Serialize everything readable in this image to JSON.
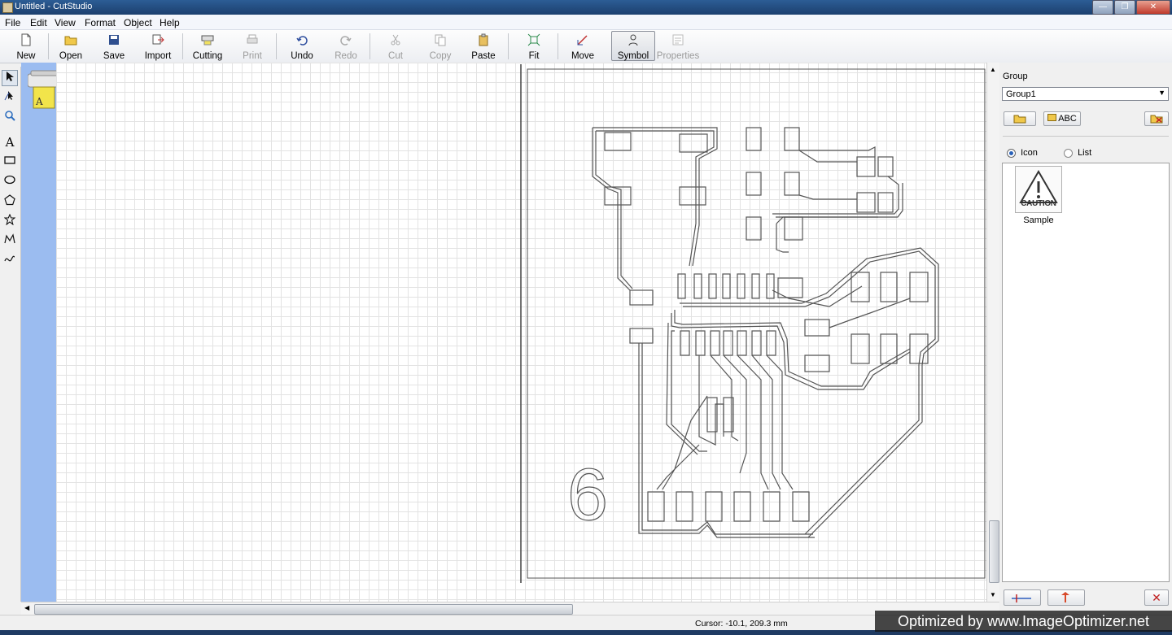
{
  "window": {
    "title": "Untitled - CutStudio"
  },
  "menu": [
    "File",
    "Edit",
    "View",
    "Format",
    "Object",
    "Help"
  ],
  "toolbar": {
    "new": "New",
    "open": "Open",
    "save": "Save",
    "import": "Import",
    "cutting": "Cutting",
    "print": "Print",
    "undo": "Undo",
    "redo": "Redo",
    "cut": "Cut",
    "copy": "Copy",
    "paste": "Paste",
    "fit": "Fit",
    "move": "Move",
    "symbol": "Symbol",
    "properties": "Properties"
  },
  "toolbox": [
    "select-tool",
    "edit-point-tool",
    "zoom-tool",
    "text-tool",
    "rectangle-tool",
    "ellipse-tool",
    "polygon-tool",
    "star-tool",
    "polyline-tool",
    "curve-tool"
  ],
  "canvas": {
    "number_label": "6"
  },
  "panel": {
    "group_label": "Group",
    "group_value": "Group1",
    "abc_button": "ABC",
    "view_icon": "Icon",
    "view_list": "List",
    "view_selected": "Icon",
    "symbol_caution": "CAUTION",
    "symbol_name": "Sample"
  },
  "status": {
    "cursor": "Cursor: -10.1, 209.3 mm"
  },
  "watermark": "Optimized by www.ImageOptimizer.net"
}
